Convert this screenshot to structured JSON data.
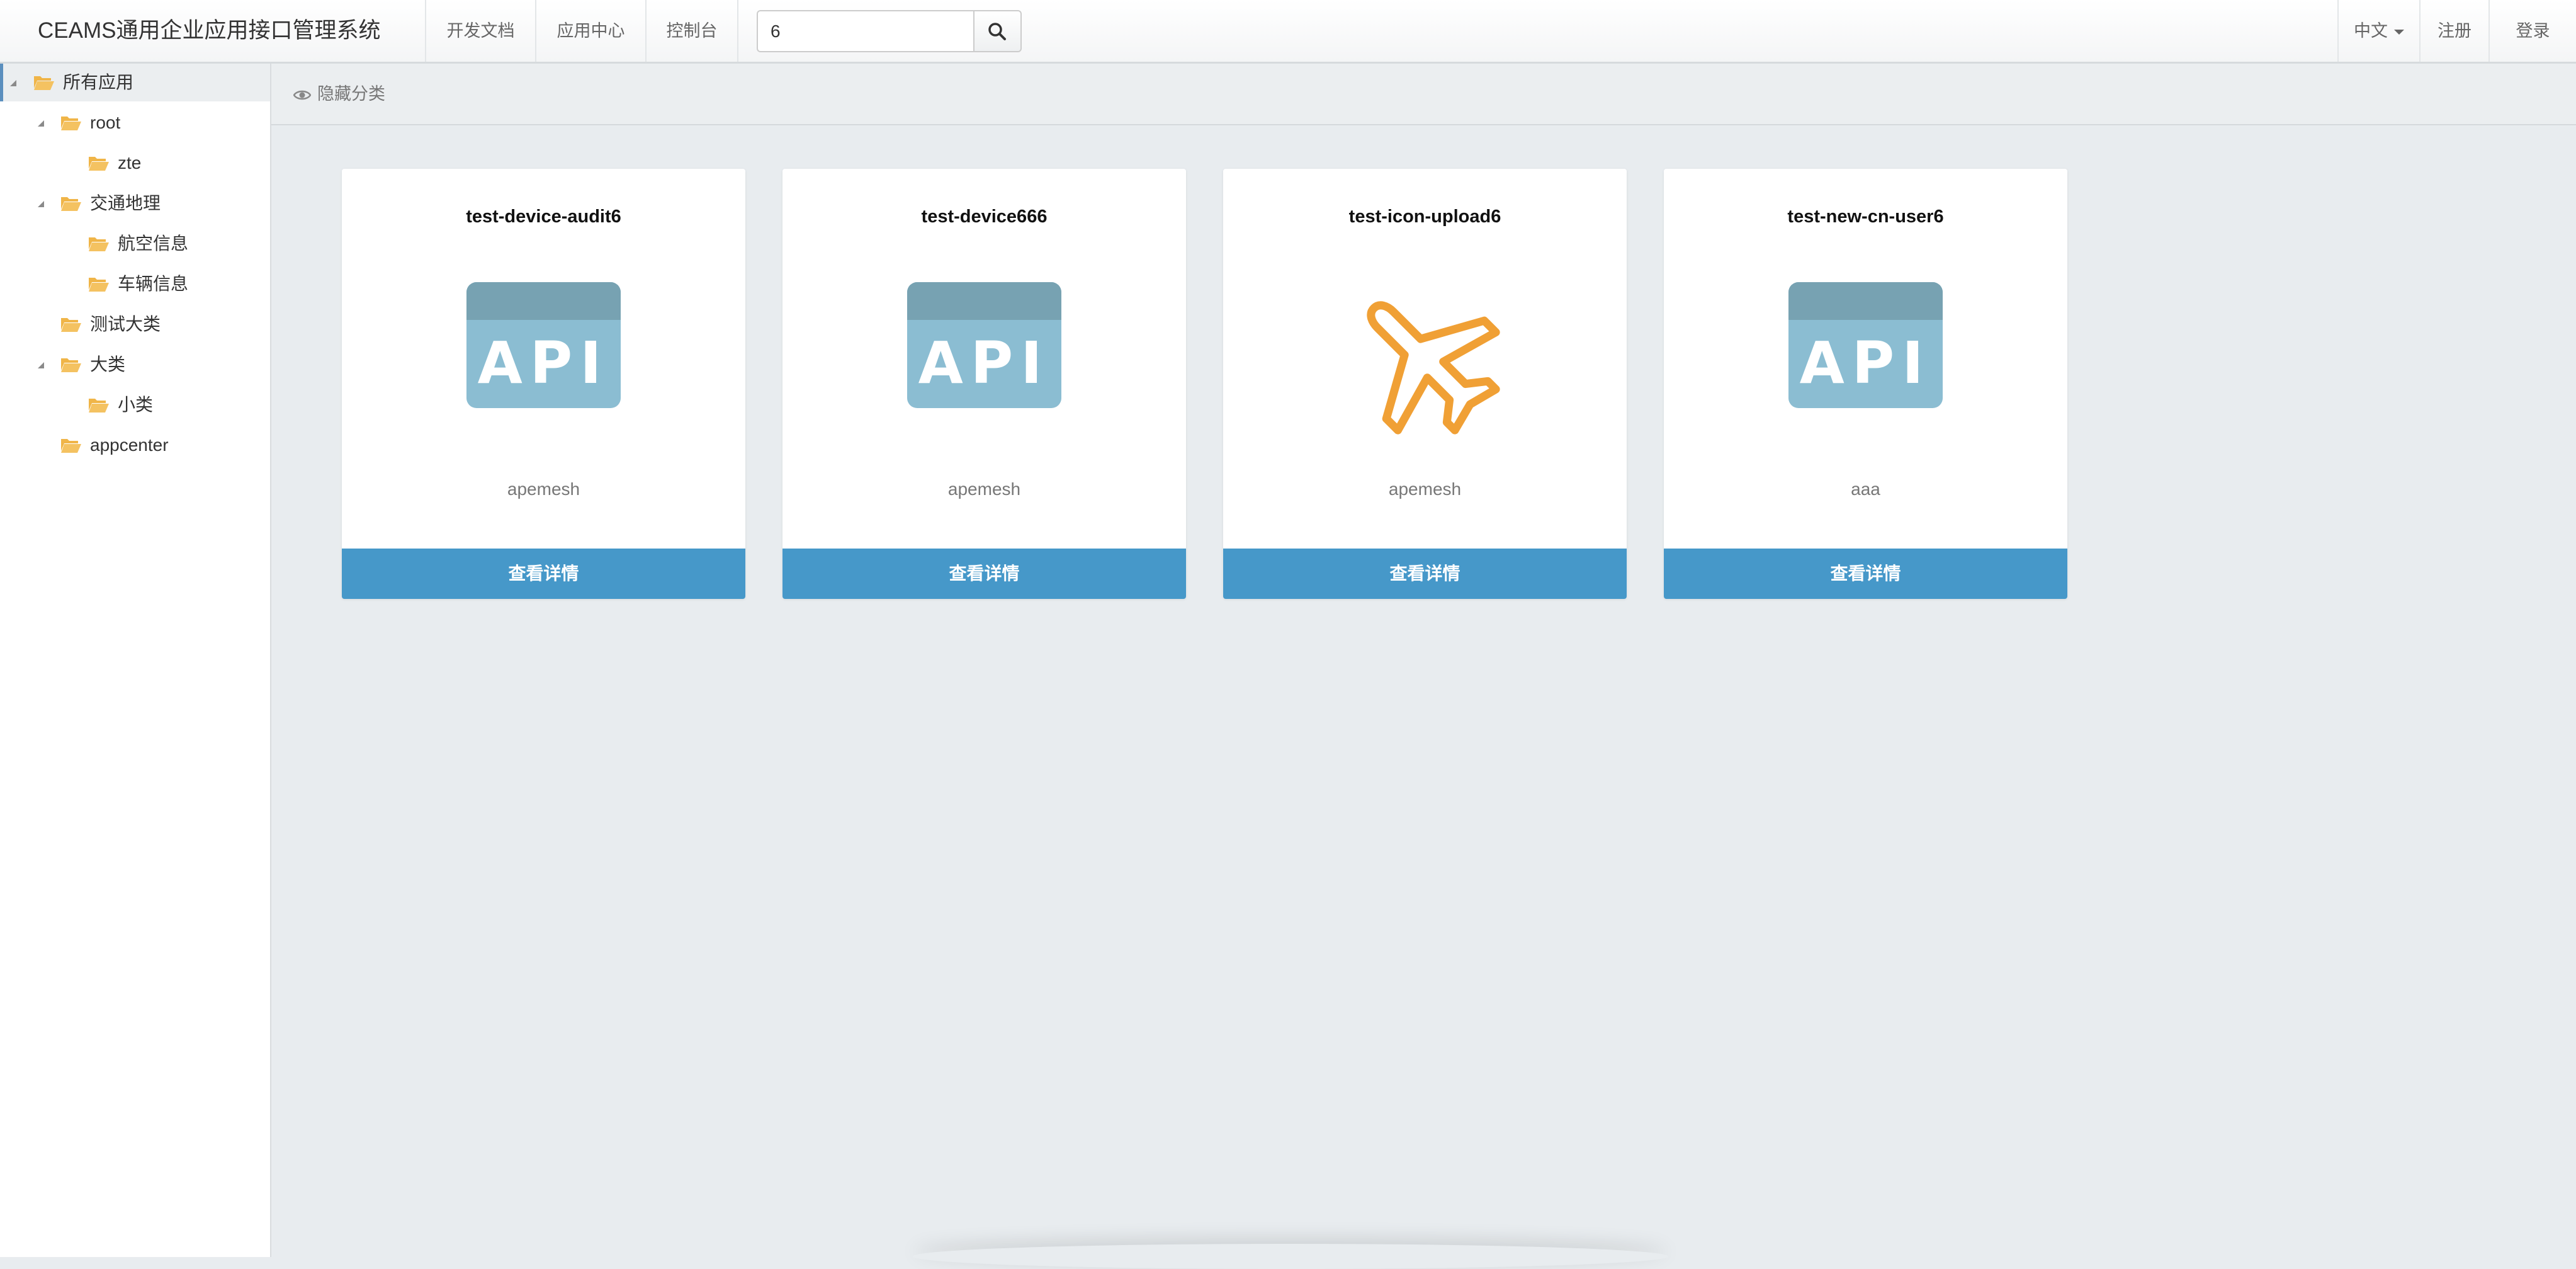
{
  "header": {
    "brand": "CEAMS通用企业应用接口管理系统",
    "nav": [
      {
        "label": "开发文档"
      },
      {
        "label": "应用中心"
      },
      {
        "label": "控制台"
      }
    ],
    "search": {
      "value": "6"
    },
    "language": "中文",
    "register": "注册",
    "login": "登录"
  },
  "sidebar": {
    "tree": [
      {
        "label": "所有应用"
      },
      {
        "label": "root"
      },
      {
        "label": "zte"
      },
      {
        "label": "交通地理"
      },
      {
        "label": "航空信息"
      },
      {
        "label": "车辆信息"
      },
      {
        "label": "测试大类"
      },
      {
        "label": "大类"
      },
      {
        "label": "小类"
      },
      {
        "label": "appcenter"
      }
    ]
  },
  "toolbar": {
    "hide_category": "隐藏分类"
  },
  "cards": [
    {
      "title": "test-device-audit6",
      "icon": "api-icon",
      "author": "apemesh",
      "button": "查看详情"
    },
    {
      "title": "test-device666",
      "icon": "api-icon",
      "author": "apemesh",
      "button": "查看详情"
    },
    {
      "title": "test-icon-upload6",
      "icon": "airplane-icon",
      "author": "apemesh",
      "button": "查看详情"
    },
    {
      "title": "test-new-cn-user6",
      "icon": "api-icon",
      "author": "aaa",
      "button": "查看详情"
    }
  ],
  "colors": {
    "accent": "#4698c9",
    "folder": "#f0b548",
    "api_icon": "#8bbdd2",
    "airplane": "#f0a035"
  }
}
